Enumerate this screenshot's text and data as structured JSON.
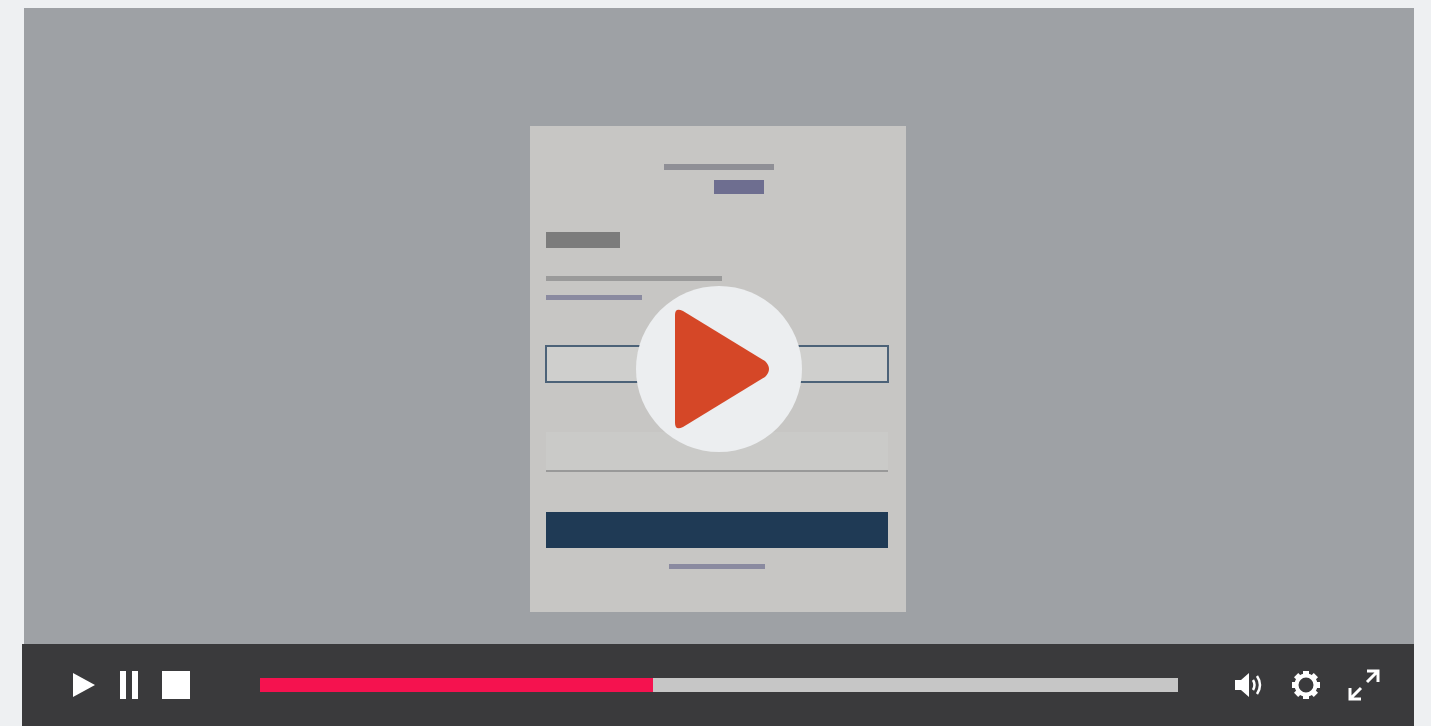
{
  "big_play_button": true,
  "left_controls": [
    {
      "kind": "play"
    },
    {
      "kind": "pause"
    },
    {
      "kind": "stop"
    }
  ],
  "progress": {
    "level": 0.428
  },
  "right_controls": [
    {
      "kind": "volume"
    },
    {
      "kind": "settings"
    },
    {
      "kind": "fullscreen"
    }
  ]
}
